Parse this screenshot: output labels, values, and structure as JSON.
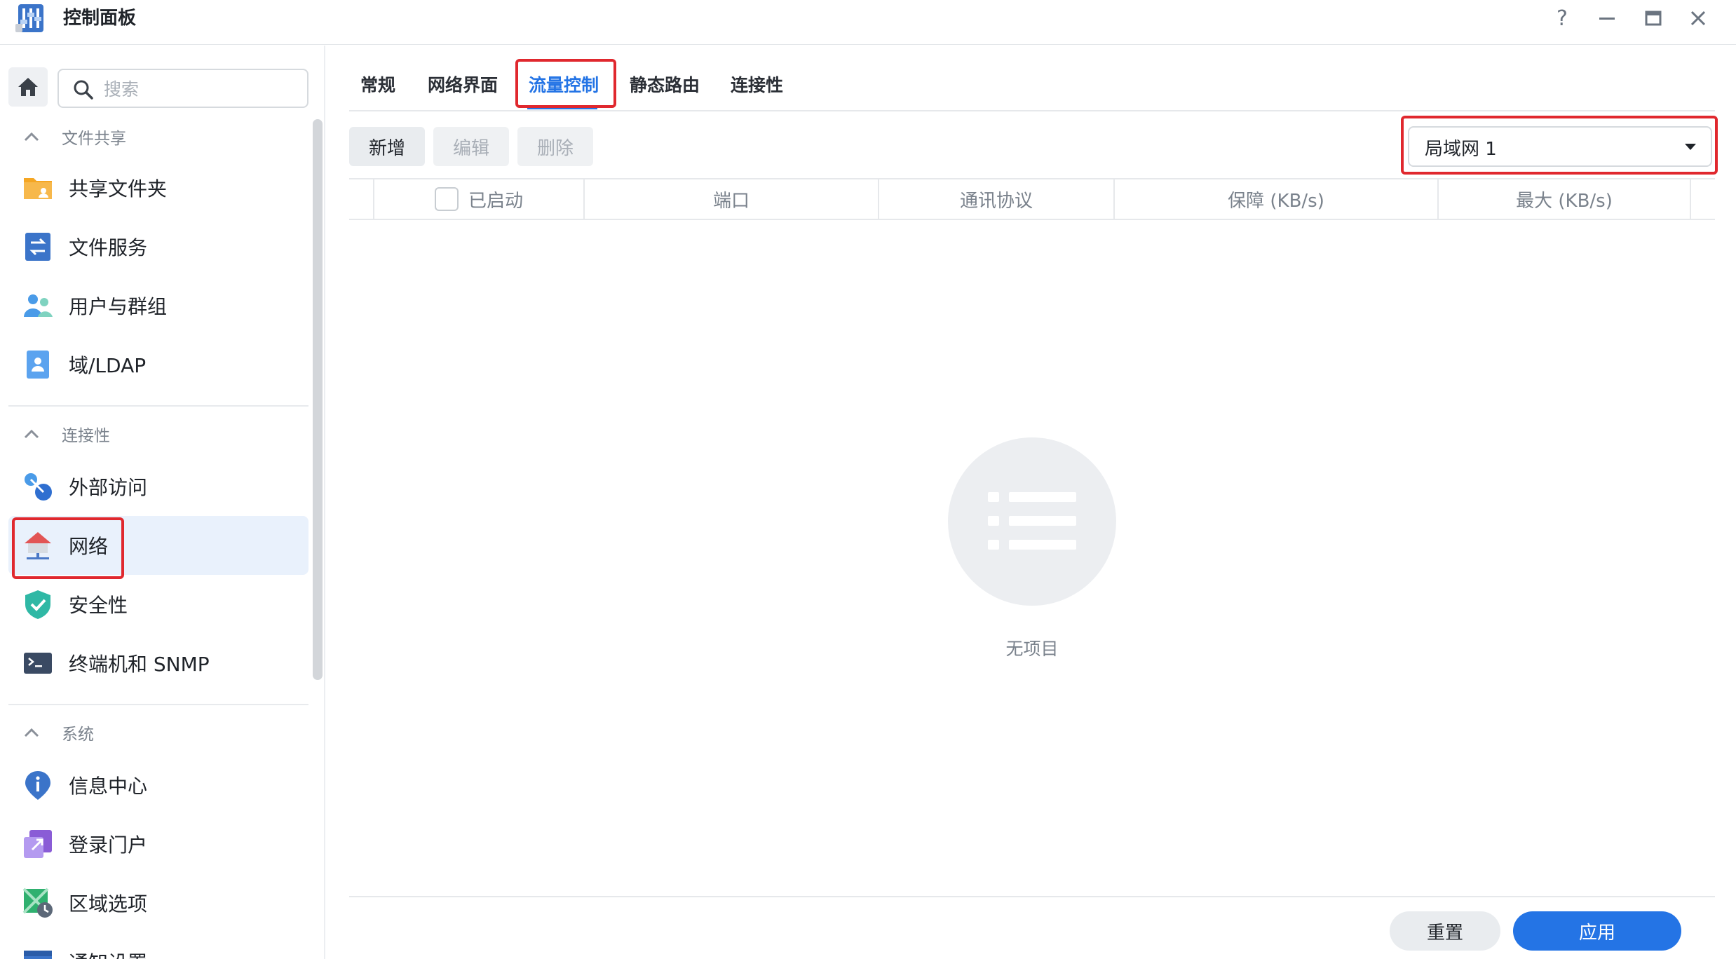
{
  "window": {
    "title": "控制面板",
    "help_label": "?"
  },
  "sidebar": {
    "search_placeholder": "搜索",
    "sections": [
      {
        "title": "文件共享"
      },
      {
        "title": "连接性"
      },
      {
        "title": "系统"
      }
    ],
    "items": [
      {
        "label": "共享文件夹"
      },
      {
        "label": "文件服务"
      },
      {
        "label": "用户与群组"
      },
      {
        "label": "域/LDAP"
      },
      {
        "label": "外部访问"
      },
      {
        "label": "网络"
      },
      {
        "label": "安全性"
      },
      {
        "label": "终端机和 SNMP"
      },
      {
        "label": "信息中心"
      },
      {
        "label": "登录门户"
      },
      {
        "label": "区域选项"
      },
      {
        "label": "通知设置"
      }
    ],
    "active_item": "网络"
  },
  "tabs": [
    {
      "label": "常规"
    },
    {
      "label": "网络界面"
    },
    {
      "label": "流量控制"
    },
    {
      "label": "静态路由"
    },
    {
      "label": "连接性"
    }
  ],
  "active_tab": "流量控制",
  "toolbar": {
    "add_label": "新增",
    "edit_label": "编辑",
    "delete_label": "删除",
    "interface_select": "局域网 1"
  },
  "table": {
    "columns": [
      "已启动",
      "端口",
      "通讯协议",
      "保障 (KB/s)",
      "最大 (KB/s)"
    ],
    "rows": []
  },
  "empty_state": {
    "text": "无项目"
  },
  "footer": {
    "reset_label": "重置",
    "apply_label": "应用"
  },
  "colors": {
    "accent": "#2474e5",
    "annotation": "#e0282e",
    "active_bg": "#e9f1fc"
  }
}
